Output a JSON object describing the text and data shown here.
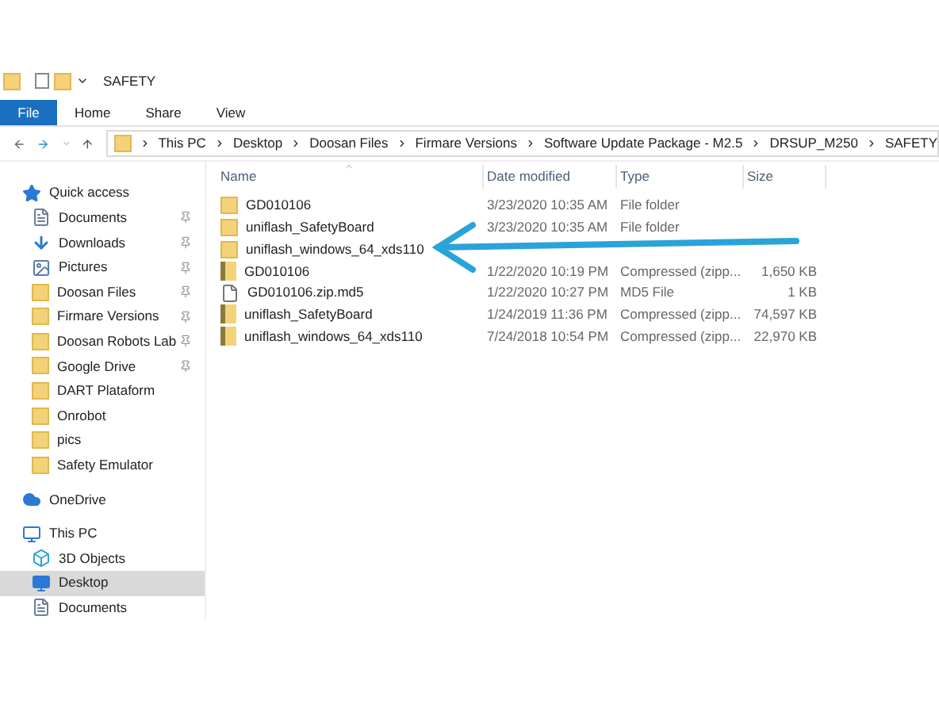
{
  "window": {
    "title": "SAFETY"
  },
  "ribbon_tabs": [
    {
      "label": "File",
      "selected": true
    },
    {
      "label": "Home",
      "selected": false
    },
    {
      "label": "Share",
      "selected": false
    },
    {
      "label": "View",
      "selected": false
    }
  ],
  "breadcrumbs": [
    "This PC",
    "Desktop",
    "Doosan Files",
    "Firmare Versions",
    "Software Update Package - M2.5",
    "DRSUP_M250",
    "SAFETY"
  ],
  "sidebar": {
    "items": [
      {
        "label": "Quick access",
        "kind": "star",
        "pinned": false,
        "selected": false,
        "children": [
          {
            "label": "Documents",
            "kind": "document",
            "pinned": true,
            "selected": false
          },
          {
            "label": "Downloads",
            "kind": "download",
            "pinned": true,
            "selected": false
          },
          {
            "label": "Pictures",
            "kind": "picture",
            "pinned": true,
            "selected": false
          },
          {
            "label": "Doosan Files",
            "kind": "folder",
            "pinned": true,
            "selected": false
          },
          {
            "label": "Firmare Versions",
            "kind": "folder",
            "pinned": true,
            "selected": false
          },
          {
            "label": "Doosan Robots Lab",
            "kind": "folder",
            "pinned": true,
            "selected": false
          },
          {
            "label": "Google Drive",
            "kind": "folder",
            "pinned": true,
            "selected": false
          },
          {
            "label": "DART Plataform",
            "kind": "folder",
            "pinned": false,
            "selected": false
          },
          {
            "label": "Onrobot",
            "kind": "folder",
            "pinned": false,
            "selected": false
          },
          {
            "label": "pics",
            "kind": "folder",
            "pinned": false,
            "selected": false
          },
          {
            "label": "Safety Emulator",
            "kind": "folder",
            "pinned": false,
            "selected": false
          }
        ]
      },
      {
        "label": "OneDrive",
        "kind": "cloud",
        "pinned": false,
        "selected": false
      },
      {
        "label": "This PC",
        "kind": "pc",
        "pinned": false,
        "selected": false,
        "children": [
          {
            "label": "3D Objects",
            "kind": "cube",
            "pinned": false,
            "selected": false
          },
          {
            "label": "Desktop",
            "kind": "desktop",
            "pinned": false,
            "selected": true
          },
          {
            "label": "Documents",
            "kind": "document",
            "pinned": false,
            "selected": false
          }
        ]
      }
    ]
  },
  "table": {
    "columns": [
      "Name",
      "Date modified",
      "Type",
      "Size"
    ],
    "rows": [
      {
        "kind": "folder",
        "name": "GD010106",
        "date": "3/23/2020 10:35 AM",
        "type": "File folder"
      },
      {
        "kind": "folder",
        "name": "uniflash_SafetyBoard",
        "date": "3/23/2020 10:35 AM",
        "type": "File folder"
      },
      {
        "kind": "folder",
        "name": "uniflash_windows_64_xds110"
      },
      {
        "kind": "zip",
        "name": "GD010106",
        "date": "1/22/2020 10:19 PM",
        "type": "Compressed (zipp...",
        "size": "1,650 KB"
      },
      {
        "kind": "file",
        "name": "GD010106.zip.md5",
        "date": "1/22/2020 10:27 PM",
        "type": "MD5 File",
        "size": "1 KB"
      },
      {
        "kind": "zip",
        "name": "uniflash_SafetyBoard",
        "date": "1/24/2019 11:36 PM",
        "type": "Compressed (zipp...",
        "size": "74,597 KB"
      },
      {
        "kind": "zip",
        "name": "uniflash_windows_64_xds110",
        "date": "7/24/2018 10:54 PM",
        "type": "Compressed (zipp...",
        "size": "22,970 KB"
      }
    ]
  }
}
